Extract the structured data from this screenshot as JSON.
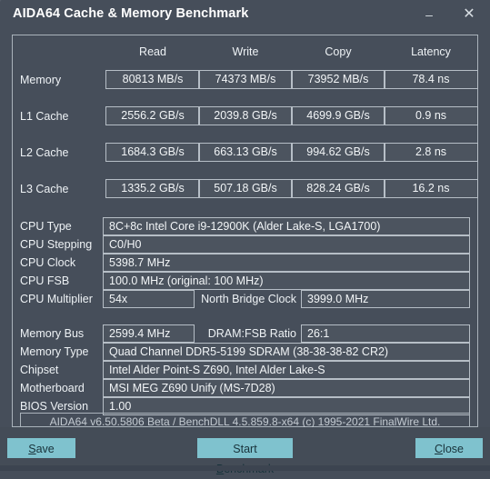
{
  "window": {
    "title": "AIDA64 Cache & Memory Benchmark",
    "minimize_icon": "minimize-icon",
    "minimize_glyph": "–",
    "close_icon": "close-icon",
    "close_glyph": "✕"
  },
  "benchmark": {
    "columns": [
      "Read",
      "Write",
      "Copy",
      "Latency"
    ],
    "rows": [
      {
        "label": "Memory",
        "read": "80813 MB/s",
        "write": "74373 MB/s",
        "copy": "73952 MB/s",
        "latency": "78.4 ns"
      },
      {
        "label": "L1 Cache",
        "read": "2556.2 GB/s",
        "write": "2039.8 GB/s",
        "copy": "4699.9 GB/s",
        "latency": "0.9 ns"
      },
      {
        "label": "L2 Cache",
        "read": "1684.3 GB/s",
        "write": "663.13 GB/s",
        "copy": "994.62 GB/s",
        "latency": "2.8 ns"
      },
      {
        "label": "L3 Cache",
        "read": "1335.2 GB/s",
        "write": "507.18 GB/s",
        "copy": "828.24 GB/s",
        "latency": "16.2 ns"
      }
    ]
  },
  "cpu_info": {
    "cpu_type_label": "CPU Type",
    "cpu_type_value": "8C+8c Intel Core i9-12900K  (Alder Lake-S, LGA1700)",
    "cpu_stepping_label": "CPU Stepping",
    "cpu_stepping_value": "C0/H0",
    "cpu_clock_label": "CPU Clock",
    "cpu_clock_value": "5398.7 MHz",
    "cpu_fsb_label": "CPU FSB",
    "cpu_fsb_value": "100.0 MHz  (original: 100 MHz)",
    "cpu_multiplier_label": "CPU Multiplier",
    "cpu_multiplier_value": "54x",
    "north_bridge_label": "North Bridge Clock",
    "north_bridge_value": "3999.0 MHz"
  },
  "memory_info": {
    "memory_bus_label": "Memory Bus",
    "memory_bus_value": "2599.4 MHz",
    "dram_fsb_label": "DRAM:FSB Ratio",
    "dram_fsb_value": "26:1",
    "memory_type_label": "Memory Type",
    "memory_type_value": "Quad Channel DDR5-5199 SDRAM  (38-38-38-82 CR2)",
    "chipset_label": "Chipset",
    "chipset_value": "Intel Alder Point-S Z690, Intel Alder Lake-S",
    "motherboard_label": "Motherboard",
    "motherboard_value": "MSI MEG Z690 Unify (MS-7D28)",
    "bios_label": "BIOS Version",
    "bios_value": "1.00"
  },
  "footer": {
    "version_text": "AIDA64 v6.50.5806 Beta / BenchDLL 4.5.859.8-x64  (c) 1995-2021 FinalWire Ltd."
  },
  "buttons": {
    "save": {
      "pre": "",
      "accel": "S",
      "post": "ave"
    },
    "start": {
      "pre": "Start ",
      "accel": "B",
      "post": "enchmark"
    },
    "close": {
      "pre": "",
      "accel": "C",
      "post": "lose"
    }
  },
  "colors": {
    "window_bg": "#464e5a",
    "button_accent": "#7fc2ce",
    "border": "#b6bec6",
    "text": "#eef2f5"
  }
}
